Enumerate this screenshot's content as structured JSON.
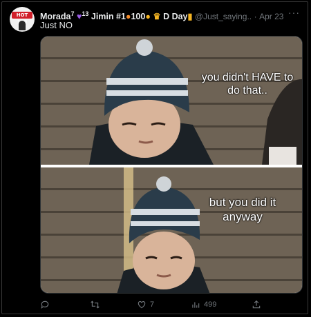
{
  "tweet": {
    "display_name": "Morada",
    "name_sup": "7",
    "name_sup2": "13",
    "name_rest": "Jimin #1",
    "name_num": "100",
    "name_end": "D Day",
    "handle": "@Just_saying..",
    "dot": "·",
    "date": "Apr 23",
    "text": "Just NO"
  },
  "avatar": {
    "badge_text": "HOT 100"
  },
  "meme": {
    "caption_top": "you didn't HAVE to do that..",
    "caption_bottom": "but you did it anyway"
  },
  "actions": {
    "likes": "7",
    "views": "499"
  },
  "icons": {
    "reply": "reply-icon",
    "retweet": "retweet-icon",
    "like": "like-icon",
    "views": "views-icon",
    "share": "share-icon",
    "more": "more-icon"
  },
  "colors": {
    "background": "#000000",
    "text": "#e7e9ea",
    "muted": "#71767b"
  }
}
